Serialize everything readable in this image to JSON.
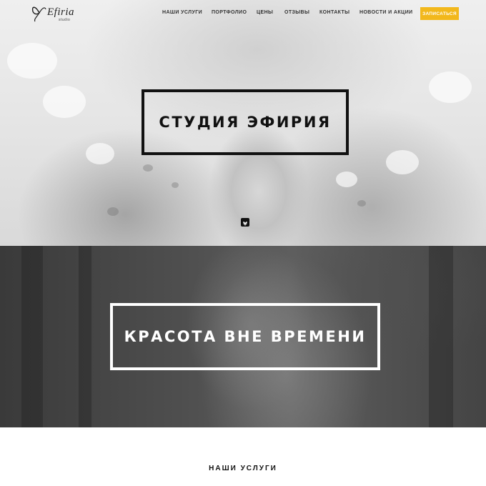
{
  "header": {
    "logo_text": "Efiria",
    "logo_sub": "studio",
    "nav": [
      {
        "label": "НАШИ УСЛУГИ"
      },
      {
        "label": "ПОРТФОЛИО"
      },
      {
        "label": "ЦЕНЫ"
      },
      {
        "label": "ОТЗЫВЫ"
      },
      {
        "label": "КОНТАКТЫ"
      },
      {
        "label": "НОВОСТИ И АКЦИИ"
      }
    ],
    "cta_label": "ЗАПИСАТЬСЯ",
    "cta_color": "#f2b81c"
  },
  "hero1": {
    "title": "СТУДИЯ ЭФИРИЯ",
    "scroll_icon": "chevron-down-icon"
  },
  "hero2": {
    "title": "КРАСОТА ВНЕ ВРЕМЕНИ"
  },
  "services": {
    "title": "НАШИ УСЛУГИ"
  }
}
